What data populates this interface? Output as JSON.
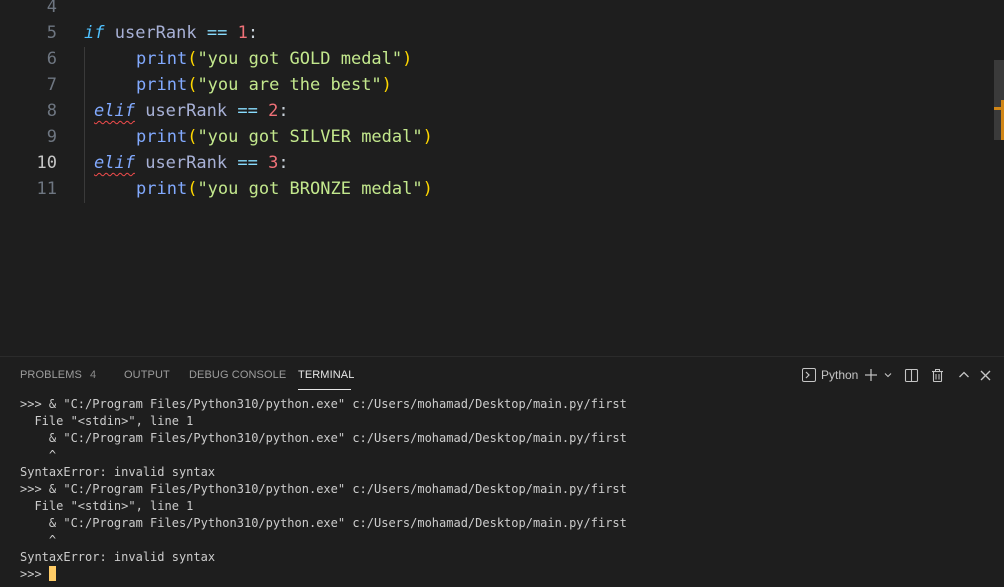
{
  "editor": {
    "lines": [
      {
        "n": "4",
        "segments": []
      },
      {
        "n": "5",
        "segments": [
          {
            "c": "kw",
            "t": "if"
          },
          {
            "c": "punc",
            "t": " "
          },
          {
            "c": "var",
            "t": "userRank"
          },
          {
            "c": "punc",
            "t": " "
          },
          {
            "c": "op",
            "t": "=="
          },
          {
            "c": "punc",
            "t": " "
          },
          {
            "c": "num",
            "t": "1"
          },
          {
            "c": "punc",
            "t": ":"
          }
        ]
      },
      {
        "n": "6",
        "segments": [
          {
            "c": "fn",
            "t": "print"
          },
          {
            "c": "paren",
            "t": "("
          },
          {
            "c": "str",
            "t": "\"you got GOLD medal\""
          },
          {
            "c": "paren",
            "t": ")"
          }
        ]
      },
      {
        "n": "7",
        "segments": [
          {
            "c": "fn",
            "t": "print"
          },
          {
            "c": "paren",
            "t": "("
          },
          {
            "c": "str",
            "t": "\"you are the best\""
          },
          {
            "c": "paren",
            "t": ")"
          }
        ]
      },
      {
        "n": "8",
        "segments": [
          {
            "c": "kw2 squiggle",
            "t": "elif"
          },
          {
            "c": "punc",
            "t": " "
          },
          {
            "c": "var",
            "t": "userRank"
          },
          {
            "c": "punc",
            "t": " "
          },
          {
            "c": "op",
            "t": "=="
          },
          {
            "c": "punc",
            "t": " "
          },
          {
            "c": "num",
            "t": "2"
          },
          {
            "c": "punc",
            "t": ":"
          }
        ]
      },
      {
        "n": "9",
        "segments": [
          {
            "c": "fn",
            "t": "print"
          },
          {
            "c": "paren",
            "t": "("
          },
          {
            "c": "str",
            "t": "\"you got SILVER medal\""
          },
          {
            "c": "paren",
            "t": ")"
          }
        ]
      },
      {
        "n": "10",
        "segments": [
          {
            "c": "kw2 squiggle",
            "t": "elif"
          },
          {
            "c": "punc",
            "t": " "
          },
          {
            "c": "var",
            "t": "userRank"
          },
          {
            "c": "punc",
            "t": " "
          },
          {
            "c": "op",
            "t": "=="
          },
          {
            "c": "punc",
            "t": " "
          },
          {
            "c": "num",
            "t": "3"
          },
          {
            "c": "punc",
            "t": ":"
          }
        ]
      },
      {
        "n": "11",
        "segments": [
          {
            "c": "fn",
            "t": "print"
          },
          {
            "c": "paren",
            "t": "("
          },
          {
            "c": "str",
            "t": "\"you got BRONZE medal\""
          },
          {
            "c": "paren",
            "t": ")"
          }
        ]
      }
    ]
  },
  "panel": {
    "tabs": {
      "problems": "PROBLEMS",
      "problems_count": "4",
      "output": "OUTPUT",
      "debug_console": "DEBUG CONSOLE",
      "terminal": "TERMINAL"
    },
    "actions": {
      "terminal_profile": "Python",
      "terminal_icon": "terminal-icon",
      "add_icon": "plus-icon",
      "dropdown_icon": "chevron-down-icon",
      "split_icon": "split-icon",
      "trash_icon": "trash-icon",
      "maximize_icon": "chevron-up-icon",
      "close_icon": "close-icon"
    }
  },
  "terminal": {
    "lines": [
      ">>> & \"C:/Program Files/Python310/python.exe\" c:/Users/mohamad/Desktop/main.py/first",
      "  File \"<stdin>\", line 1",
      "    & \"C:/Program Files/Python310/python.exe\" c:/Users/mohamad/Desktop/main.py/first",
      "    ^",
      "SyntaxError: invalid syntax",
      ">>> & \"C:/Program Files/Python310/python.exe\" c:/Users/mohamad/Desktop/main.py/first",
      "  File \"<stdin>\", line 1",
      "    & \"C:/Program Files/Python310/python.exe\" c:/Users/mohamad/Desktop/main.py/first",
      "    ^",
      "SyntaxError: invalid syntax"
    ],
    "prompt": ">>> "
  },
  "colors": {
    "background": "#1e1e1e",
    "keyword": "#4fc1ff",
    "string": "#c3e88d",
    "number": "#f07178",
    "function": "#82aaff",
    "cursor": "#ffcc66",
    "error": "#f14c4c"
  }
}
